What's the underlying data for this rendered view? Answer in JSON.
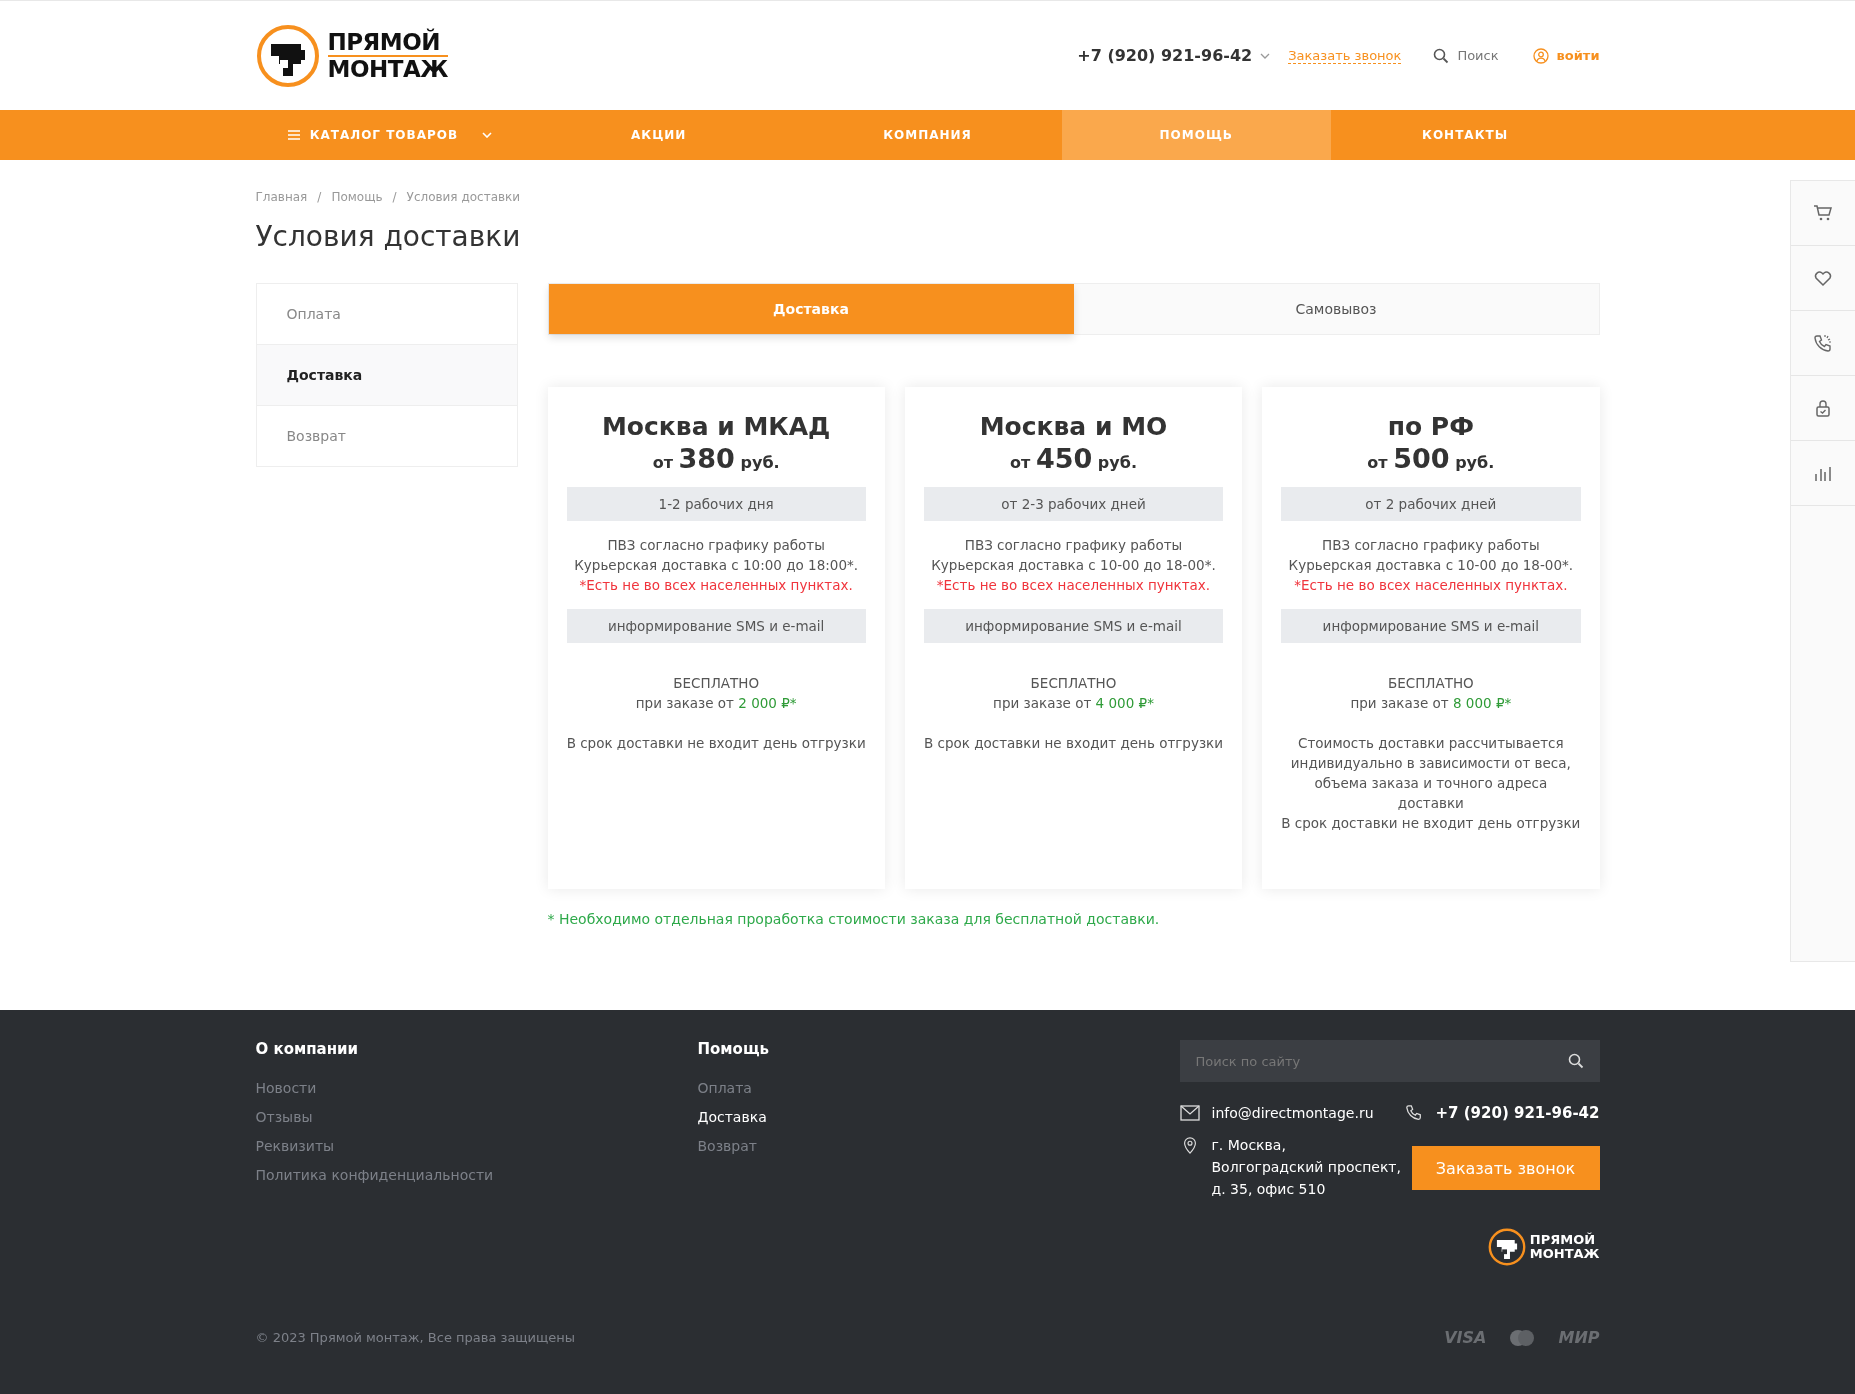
{
  "header": {
    "logo": {
      "line_1": "ПРЯМОЙ",
      "line_2": "МОНТАЖ"
    },
    "phone": "+7 (920) 921-96-42",
    "callback_link": "Заказать звонок",
    "search_label": "Поиск",
    "login_label": "войти"
  },
  "nav": [
    {
      "label": "КАТАЛОГ ТОВАРОВ",
      "kind": "catalog",
      "selected": false
    },
    {
      "label": "АКЦИИ",
      "kind": "link",
      "selected": false
    },
    {
      "label": "КОМПАНИЯ",
      "kind": "link",
      "selected": false
    },
    {
      "label": "ПОМОЩЬ",
      "kind": "link",
      "selected": true
    },
    {
      "label": "КОНТАКТЫ",
      "kind": "link",
      "selected": false
    }
  ],
  "breadcrumbs": [
    "Главная",
    "Помощь",
    "Условия доставки"
  ],
  "breadcrumb_separator": "/",
  "page_title": "Условия доставки",
  "sidebar": {
    "items": [
      {
        "label": "Оплата",
        "selected": false
      },
      {
        "label": "Доставка",
        "selected": true
      },
      {
        "label": "Возврат",
        "selected": false
      }
    ]
  },
  "tabs": [
    {
      "label": "Доставка",
      "selected": true
    },
    {
      "label": "Самовывоз",
      "selected": false
    }
  ],
  "cards": [
    {
      "title": "Москва и МКАД",
      "price_prefix": "от",
      "price": "380",
      "price_suffix": "руб.",
      "term": "1-2 рабочих дня",
      "schedule": [
        "ПВЗ согласно графику работы",
        "Курьерская доставка с 10:00 до 18:00*."
      ],
      "warning": "*Есть не во всех населенных пунктах.",
      "info": "информирование SMS и e-mail",
      "free_label": "БЕСПЛАТНО",
      "free_prefix": "при заказе от",
      "free_amount": "2 000 ₽*",
      "notes": [
        "В срок доставки не входит день отгрузки"
      ]
    },
    {
      "title": "Москва и МО",
      "price_prefix": "от",
      "price": "450",
      "price_suffix": "руб.",
      "term": "от 2-3 рабочих дней",
      "schedule": [
        "ПВЗ согласно графику работы",
        "Курьерская доставка с 10-00 до 18-00*."
      ],
      "warning": "*Есть не во всех населенных пунктах.",
      "info": "информирование SMS и e-mail",
      "free_label": "БЕСПЛАТНО",
      "free_prefix": "при заказе от",
      "free_amount": "4 000 ₽*",
      "notes": [
        "В срок доставки не входит день отгрузки"
      ]
    },
    {
      "title": "по РФ",
      "price_prefix": "от",
      "price": "500",
      "price_suffix": "руб.",
      "term": "от 2 рабочих дней",
      "schedule": [
        "ПВЗ согласно графику работы",
        "Курьерская доставка с 10-00 до 18-00*."
      ],
      "warning": "*Есть не во всех населенных пунктах.",
      "info": "информирование SMS и e-mail",
      "free_label": "БЕСПЛАТНО",
      "free_prefix": "при заказе от",
      "free_amount": "8 000 ₽*",
      "notes": [
        "Стоимость доставки рассчитывается индивидуально в зависимости от веса, объема заказа и точного адреса доставки",
        "В срок доставки не входит день отгрузки"
      ]
    }
  ],
  "footnote": "* Необходимо отдельная проработка стоимости заказа для бесплатной доставки.",
  "side_panel": [
    {
      "kind": "cart"
    },
    {
      "kind": "heart"
    },
    {
      "kind": "phone"
    },
    {
      "kind": "lock"
    },
    {
      "kind": "chart"
    }
  ],
  "footer": {
    "columns": [
      {
        "title": "О компании",
        "links": [
          {
            "label": "Новости",
            "selected": false
          },
          {
            "label": "Отзывы",
            "selected": false
          },
          {
            "label": "Реквизиты",
            "selected": false
          },
          {
            "label": "Политика конфиденциальности",
            "selected": false
          }
        ]
      },
      {
        "title": "Помощь",
        "links": [
          {
            "label": "Оплата",
            "selected": false
          },
          {
            "label": "Доставка",
            "selected": true
          },
          {
            "label": "Возврат",
            "selected": false
          }
        ]
      }
    ],
    "search": {
      "placeholder": "Поиск по сайту"
    },
    "email": "info@directmontage.ru",
    "phone": "+7 (920) 921-96-42",
    "address": "г. Москва, Волгоградский проспект, д. 35, офис 510",
    "callback_button": "Заказать звонок",
    "logo": {
      "line_1": "ПРЯМОЙ",
      "line_2": "МОНТАЖ"
    },
    "copyright": "© 2023 Прямой монтаж, Все права защищены",
    "payments": [
      {
        "kind": "text",
        "label": "VISA"
      },
      {
        "kind": "mastercard"
      },
      {
        "kind": "text",
        "label": "МИР"
      }
    ]
  }
}
